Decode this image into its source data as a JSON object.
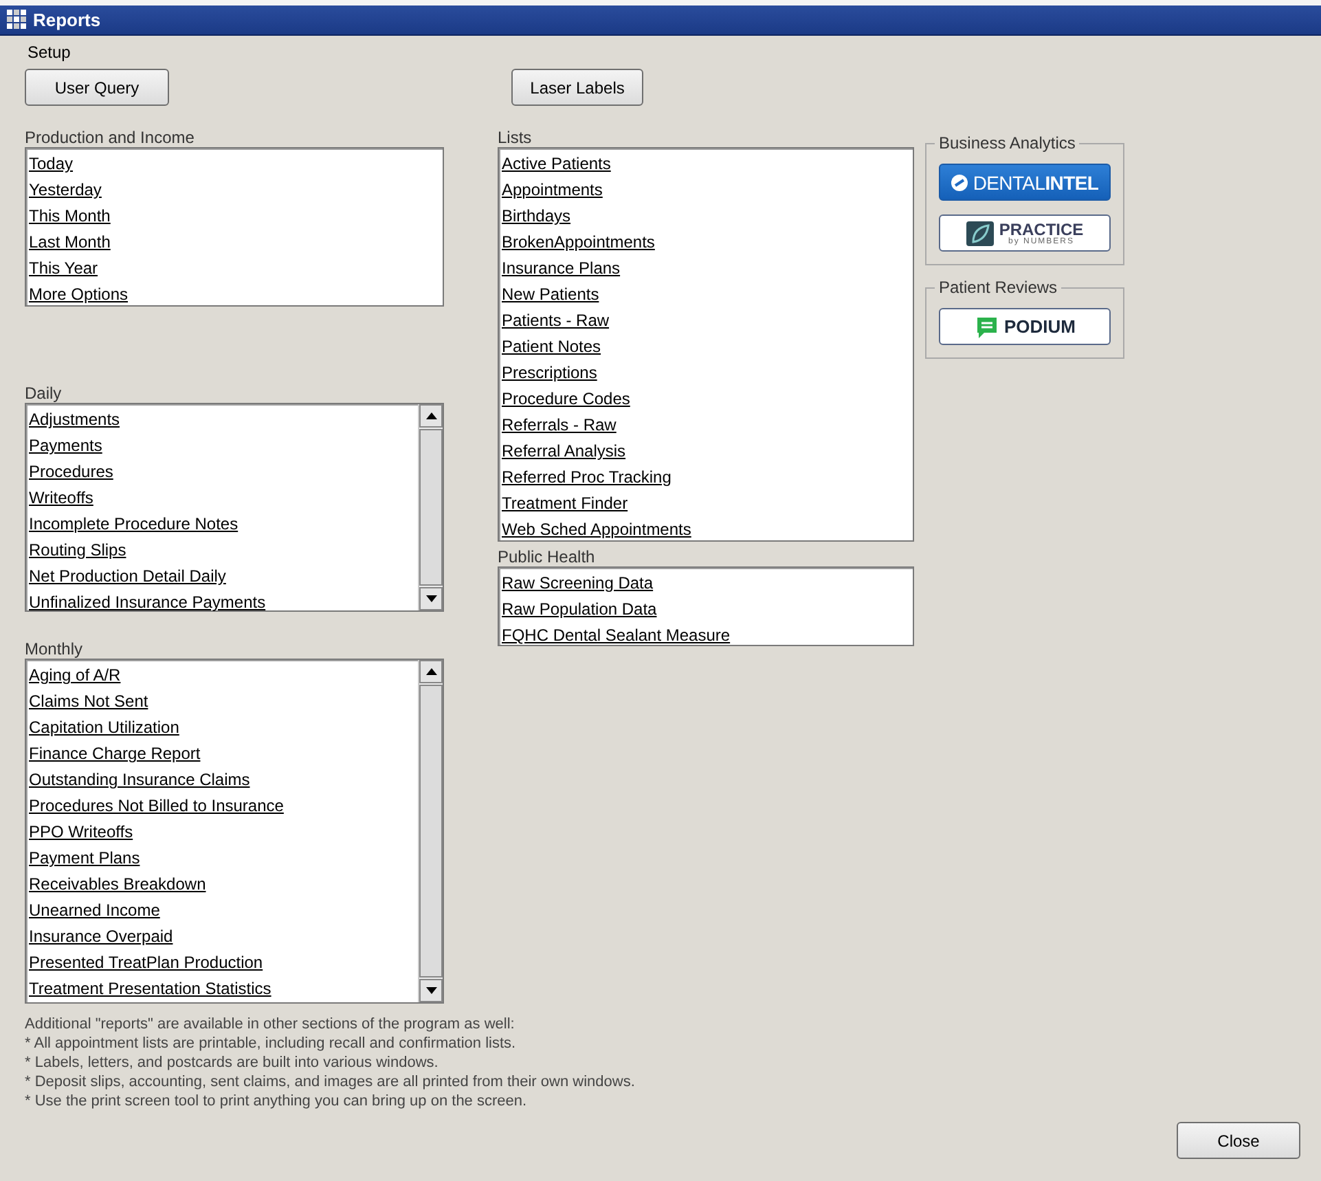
{
  "window": {
    "title": "Reports"
  },
  "menu": [
    "Setup"
  ],
  "buttons": {
    "user_query": "User Query",
    "laser_labels": "Laser Labels",
    "close": "Close"
  },
  "production_and_income": {
    "label": "Production and Income",
    "items": [
      "Today",
      "Yesterday",
      "This Month",
      "Last Month",
      "This Year",
      "More Options"
    ]
  },
  "daily": {
    "label": "Daily",
    "items": [
      "Adjustments",
      "Payments",
      "Procedures",
      "Writeoffs",
      "Incomplete Procedure Notes",
      "Routing Slips",
      "Net Production Detail Daily",
      "Unfinalized Insurance Payments"
    ]
  },
  "monthly": {
    "label": "Monthly",
    "items": [
      "Aging of A/R",
      "Claims Not Sent",
      "Capitation Utilization",
      "Finance Charge Report",
      "Outstanding Insurance Claims",
      "Procedures Not Billed to Insurance",
      "PPO Writeoffs",
      "Payment Plans",
      "Receivables Breakdown",
      "Unearned Income",
      "Insurance Overpaid",
      "Presented TreatPlan Production",
      "Treatment Presentation Statistics"
    ]
  },
  "lists": {
    "label": "Lists",
    "items": [
      "Active Patients",
      "Appointments",
      "Birthdays",
      "BrokenAppointments",
      "Insurance Plans",
      "New Patients",
      "Patients - Raw",
      "Patient Notes",
      "Prescriptions",
      "Procedure Codes",
      "Referrals - Raw",
      "Referral Analysis",
      "Referred Proc Tracking",
      "Treatment Finder",
      "Web Sched Appointments"
    ]
  },
  "public_health": {
    "label": "Public Health",
    "items": [
      "Raw Screening Data",
      "Raw Population Data",
      "FQHC Dental Sealant Measure"
    ]
  },
  "business_analytics": {
    "label": "Business Analytics",
    "dental_intel": "DENTAL**INTEL**",
    "practice_by_numbers": {
      "name": "PRACTICE",
      "tagline": "by NUMBERS"
    }
  },
  "patient_reviews": {
    "label": "Patient Reviews",
    "podium": "PODIUM"
  },
  "notes": [
    "Additional \"reports\" are available in other sections of the program as well:",
    "* All appointment lists are printable, including recall and confirmation lists.",
    "* Labels, letters, and postcards are built into various windows.",
    "* Deposit slips, accounting, sent claims, and images are all printed from their own windows.",
    "* Use the print screen tool to print anything you can bring up on the screen."
  ]
}
